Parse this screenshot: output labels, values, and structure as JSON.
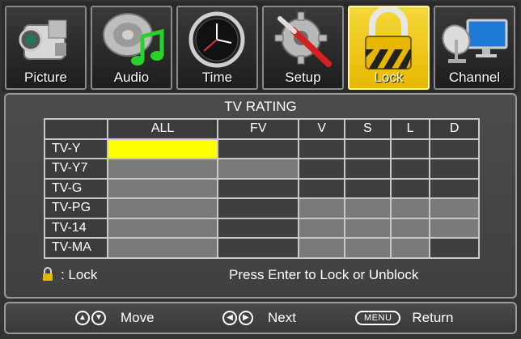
{
  "tabs": [
    {
      "label": "Picture",
      "icon": "camcorder-icon",
      "active": false
    },
    {
      "label": "Audio",
      "icon": "audio-music-icon",
      "active": false
    },
    {
      "label": "Time",
      "icon": "clock-icon",
      "active": false
    },
    {
      "label": "Setup",
      "icon": "gear-wrench-icon",
      "active": false
    },
    {
      "label": "Lock",
      "icon": "padlock-icon",
      "active": true
    },
    {
      "label": "Channel",
      "icon": "satellite-monitor-icon",
      "active": false
    }
  ],
  "panel": {
    "title": "TV RATING",
    "columns": [
      "ALL",
      "FV",
      "V",
      "S",
      "L",
      "D"
    ],
    "rows": [
      {
        "label": "TV-Y",
        "cells": [
          "selected",
          "blank",
          "blank",
          "blank",
          "blank",
          "blank"
        ]
      },
      {
        "label": "TV-Y7",
        "cells": [
          "enabled",
          "enabled",
          "blank",
          "blank",
          "blank",
          "blank"
        ]
      },
      {
        "label": "TV-G",
        "cells": [
          "enabled",
          "blank",
          "blank",
          "blank",
          "blank",
          "blank"
        ]
      },
      {
        "label": "TV-PG",
        "cells": [
          "enabled",
          "blank",
          "enabled",
          "enabled",
          "enabled",
          "enabled"
        ]
      },
      {
        "label": "TV-14",
        "cells": [
          "enabled",
          "blank",
          "enabled",
          "enabled",
          "enabled",
          "enabled"
        ]
      },
      {
        "label": "TV-MA",
        "cells": [
          "enabled",
          "blank",
          "enabled",
          "enabled",
          "enabled",
          "blank"
        ]
      }
    ],
    "legend": ": Lock",
    "hint": "Press Enter to Lock or Unblock"
  },
  "bottombar": {
    "move": {
      "icon": "up-down-arrows-icon",
      "label": "Move"
    },
    "next": {
      "icon": "left-right-arrows-icon",
      "label": "Next"
    },
    "return": {
      "button": "MENU",
      "label": "Return"
    }
  },
  "colors": {
    "selected": "#ffff00",
    "enabled": "#7a7a7a",
    "active_tab": "#f0cc1c"
  }
}
